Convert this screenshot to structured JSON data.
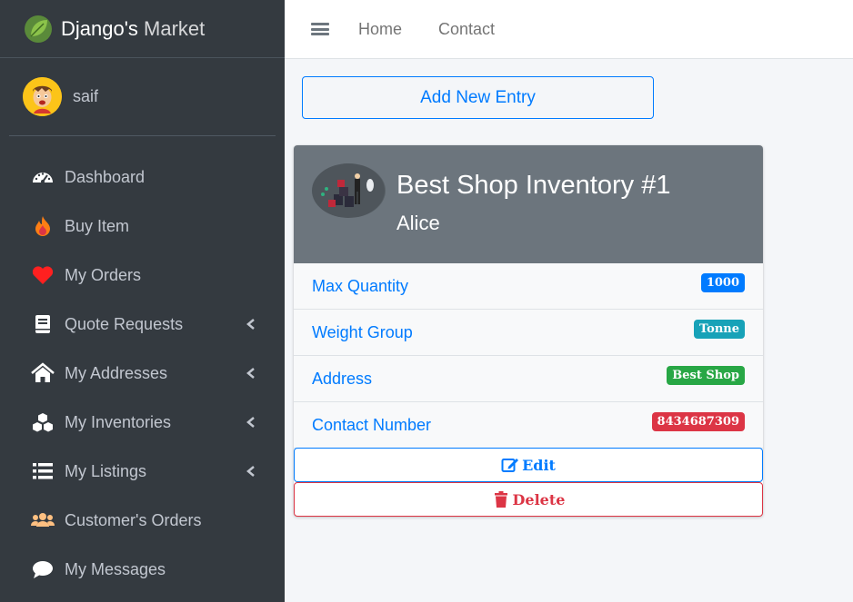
{
  "brand": {
    "name_strong": "Django's",
    "name_light": "Market",
    "logo_icon": "leaf-icon"
  },
  "user": {
    "name": "saif"
  },
  "sidebar": {
    "items": [
      {
        "label": "Dashboard",
        "icon": "dashboard-icon",
        "has_children": false
      },
      {
        "label": "Buy Item",
        "icon": "fire-icon",
        "has_children": false
      },
      {
        "label": "My Orders",
        "icon": "heart-icon",
        "has_children": false
      },
      {
        "label": "Quote Requests",
        "icon": "book-icon",
        "has_children": true
      },
      {
        "label": "My Addresses",
        "icon": "home-icon",
        "has_children": true
      },
      {
        "label": "My Inventories",
        "icon": "cubes-icon",
        "has_children": true
      },
      {
        "label": "My Listings",
        "icon": "list-icon",
        "has_children": true
      },
      {
        "label": "Customer's Orders",
        "icon": "users-icon",
        "has_children": false
      },
      {
        "label": "My Messages",
        "icon": "comment-icon",
        "has_children": false
      }
    ]
  },
  "topbar": {
    "links": [
      "Home",
      "Contact"
    ]
  },
  "actions": {
    "add_label": "Add New Entry"
  },
  "card": {
    "title": "Best Shop Inventory #1",
    "subtitle": "Alice",
    "rows": [
      {
        "label": "Max Quantity",
        "value": "1000",
        "color": "#007bff"
      },
      {
        "label": "Weight Group",
        "value": "Tonne",
        "color": "#17a2b8"
      },
      {
        "label": "Address",
        "value": "Best Shop",
        "color": "#28a745"
      },
      {
        "label": "Contact Number",
        "value": "8434687309",
        "color": "#dc3545"
      }
    ],
    "edit_label": "Edit",
    "delete_label": "Delete"
  },
  "colors": {
    "sidebar_bg": "#343a40",
    "accent": "#007bff",
    "danger": "#dc3545",
    "card_header": "#6c757d"
  }
}
